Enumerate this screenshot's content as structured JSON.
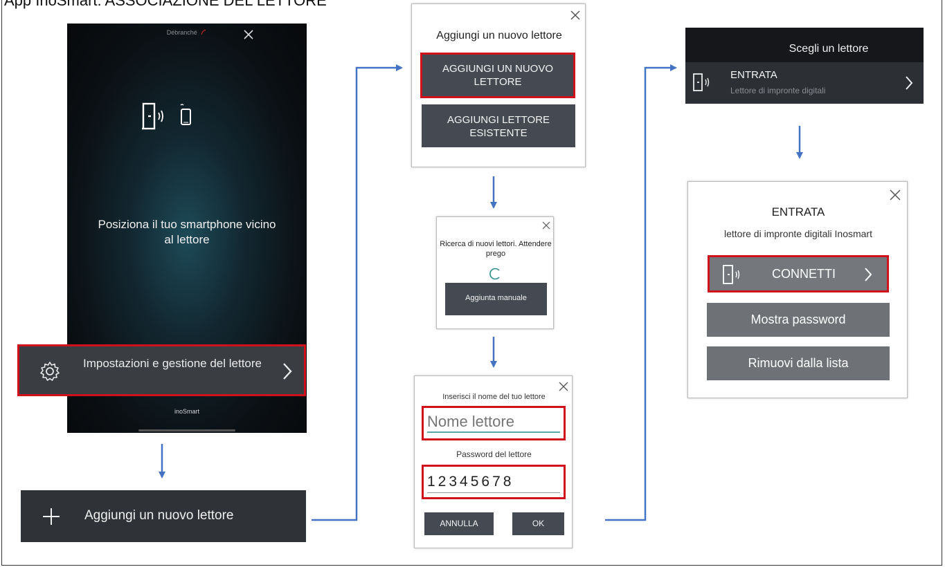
{
  "page": {
    "title": "App InoSmart: ASSOCIAZIONE DEL LETTORE"
  },
  "phone": {
    "status_text": "Débranché",
    "instruction": "Posiziona il tuo smartphone vicino al lettore",
    "settings_label": "Impostazioni e gestione del lettore",
    "brand": "inoSmart"
  },
  "add_reader": {
    "label": "Aggiungi un nuovo lettore"
  },
  "dialog_add": {
    "title": "Aggiungi un nuovo lettore",
    "new_button": "AGGIUNGI UN NUOVO LETTORE",
    "existing_button": "AGGIUNGI LETTORE ESISTENTE"
  },
  "dialog_search": {
    "message": "Ricerca di nuovi lettori. Attendere prego",
    "manual_button": "Aggiunta manuale"
  },
  "dialog_name": {
    "name_label": "Inserisci il nome del tuo lettore",
    "name_placeholder": "Nome lettore",
    "password_label": "Password del lettore",
    "password_value": "12345678",
    "cancel_button": "ANNULLA",
    "ok_button": "OK"
  },
  "choose_reader": {
    "title": "Scegli un lettore",
    "item_name": "ENTRATA",
    "item_sub": "Lettore di impronte digitali"
  },
  "reader_panel": {
    "name": "ENTRATA",
    "subtitle": "lettore di impronte digitali Inosmart",
    "connect_button": "CONNETTI",
    "show_password_button": "Mostra password",
    "remove_button": "Rimuovi dalla lista"
  },
  "colors": {
    "accent_red": "#d0101a",
    "arrow_blue": "#4473c4",
    "dark_button": "#454a52"
  }
}
